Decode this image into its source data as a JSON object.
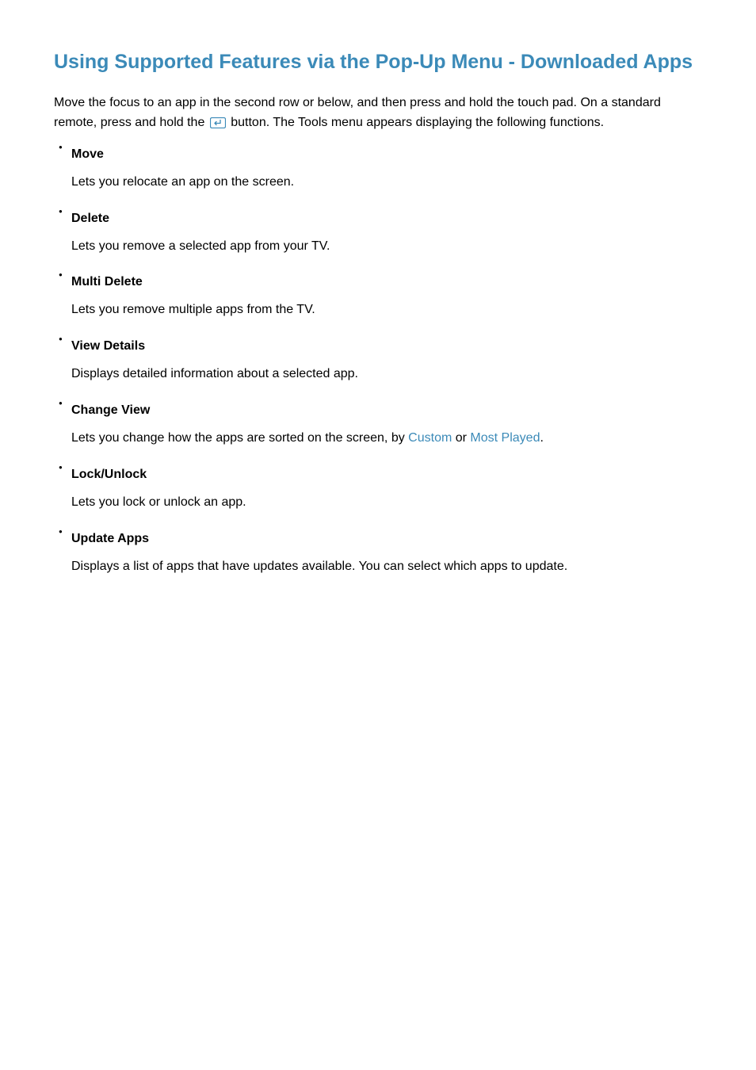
{
  "title": "Using Supported Features via the Pop-Up Menu - Downloaded Apps",
  "intro_before_icon": "Move the focus to an app in the second row or below, and then press and hold the touch pad. On a standard remote, press and hold the ",
  "intro_after_icon": " button. The Tools menu appears displaying the following functions.",
  "items": [
    {
      "title": "Move",
      "desc": "Lets you relocate an app on the screen."
    },
    {
      "title": "Delete",
      "desc": "Lets you remove a selected app from your TV."
    },
    {
      "title": "Multi Delete",
      "desc": "Lets you remove multiple apps from the TV."
    },
    {
      "title": "View Details",
      "desc": "Displays detailed information about a selected app."
    },
    {
      "title": "Change View",
      "desc_prefix": "Lets you change how the apps are sorted on the screen, by ",
      "desc_highlight1": "Custom",
      "desc_middle": " or ",
      "desc_highlight2": "Most Played",
      "desc_suffix": "."
    },
    {
      "title": "Lock/Unlock",
      "desc": "Lets you lock or unlock an app."
    },
    {
      "title": "Update Apps",
      "desc": "Displays a list of apps that have updates available. You can select which apps to update."
    }
  ]
}
